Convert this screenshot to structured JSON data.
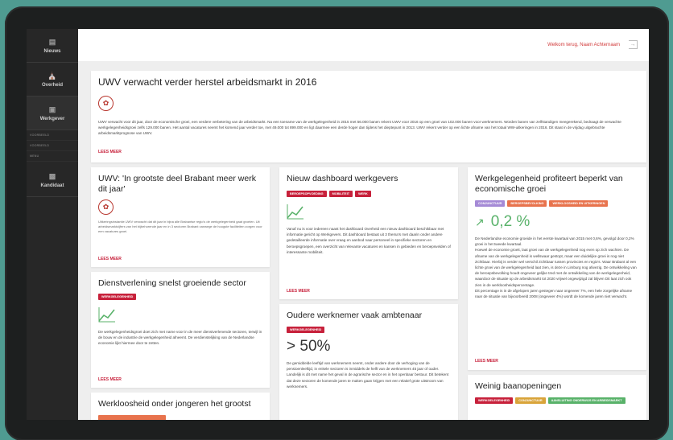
{
  "colors": {
    "accent": "#c7213b",
    "sidebar_bg": "#272727",
    "tag_purple": "#a58ad6",
    "tag_orange": "#e8734d",
    "tag_yellow": "#d9a43a",
    "tag_green": "#59b26a",
    "positive": "#59b26a"
  },
  "sidebar": {
    "items": [
      {
        "label": "Nieuws",
        "icon": "newspaper-icon"
      },
      {
        "label": "Overheid",
        "icon": "government-building-icon"
      },
      {
        "label": "Werkgever",
        "icon": "briefcase-icon"
      },
      {
        "label": "Kandidaat",
        "icon": "person-card-icon"
      }
    ],
    "subitems": [
      "Voorbeeld",
      "Voorbeeld",
      "Menu"
    ]
  },
  "topbar": {
    "welcome": "Welkom terug, Naam Achternaam"
  },
  "cards": {
    "main": {
      "title": "UWV verwacht verder herstel arbeidsmarkt in 2016",
      "icon": "flame-icon",
      "body": "UWV verwacht voor dit jaar, door de economische groei, een verdere verbetering van de arbeidsmarkt. Na een toename van de werkgelegenheid in 2015 met 56.000 banen rekent UWV voor 2016 op een groei van 102.000 banen voor werknemers. Worden banen van zelfstandigen meegerekend, bedraagt de verwachte werkgelegenheidsgroei zelfs 129.000 banen. Het aantal vacatures neemt het komend jaar verder toe, met 49.000 tot 899.000 en ligt daarmee een derde hoger dan tijdens het dieptepunt in 2013. UWV rekent verder op een lichte afname van het totaal WW-uitkeringen in 2016. Dit staat in de vrijdag uitgebrachte arbeidsmarktprognose van UWV.",
      "more": "LEES MEER"
    },
    "brabant": {
      "title": "UWV: 'In grootste deel Brabant meer werk dit jaar'",
      "icon": "flame-icon",
      "body": "Uitkeringsinstantie UWV verwacht dat dit jaar in bijna alle Brabantse regio's de werkgelegenheid gaat groeien. Uit arbeidsmarktcijfers van het bijbehorende jaar en in 3 sectoren Brabant vanwege de hoogste faciliteiten zorgen voor een vacatures groei.",
      "more": "LEES MEER"
    },
    "dienstverlening": {
      "title": "Dienstverlening snelst groeiende sector",
      "tags": [
        {
          "label": "Werkgelegenheid",
          "color": "#c7213b"
        }
      ],
      "icon": "line-chart-icon",
      "body": "De werkgelegenheidsgroei doet zich met name voor in de meer dienstverlenende sectoren, terwijl in de bouw en de industrie de werkgelegenheid afneemt. De verdienstelijking van de Nederlandse economie lijkt hiermee door te zetten.",
      "more": "LEES MEER"
    },
    "jongeren": {
      "title": "Werkloosheid onder jongeren het grootst"
    },
    "dashboard": {
      "title": "Nieuw dashboard werkgevers",
      "tags": [
        {
          "label": "Beroepsopvoeding",
          "color": "#c7213b"
        },
        {
          "label": "Mobiliteit",
          "color": "#c7213b"
        },
        {
          "label": "Werk",
          "color": "#c7213b"
        }
      ],
      "icon": "line-chart-icon",
      "body": "Vanaf nu is voor iedereen naast het dashboard Overheid een nieuw dashboard beschikbaar met informatie gericht op Werkgevers. Dit dashboard bestaat uit 3 thema's met daarin onder andere gedetailleerde informatie over vraag en aanbod naar personeel in specifieke sectoren en beroepsgroepen, een overzicht van relevante vacatures en kansen in gebieden en beroepsvelden of interessante mobiliteit.",
      "more": "LEES MEER"
    },
    "ambtenaar": {
      "title": "Oudere werknemer vaak ambtenaar",
      "tags": [
        {
          "label": "Werkgelegenheid",
          "color": "#c7213b"
        }
      ],
      "stat": "> 50%",
      "body": "De gemiddelde leeftijd van werknemers neemt, onder andere door de verhoging van de pensioenleeftijd, in enkele sectoren is inmiddels de helft van de werknemers 45 jaar of ouder. Landelijk is dit met name het geval in de agrarische sector en in het openbaar bestuur. Dit betekent dat deze sectoren de komende jaren te maken gaan krijgen met een relatief grote uitstroom van werknemers."
    },
    "groei": {
      "title": "Werkgelegenheid profiteert beperkt van economische groei",
      "tags": [
        {
          "label": "Conjunctuur",
          "color": "#a58ad6"
        },
        {
          "label": "Beroepsbevolking",
          "color": "#e8734d"
        },
        {
          "label": "Werkloosheid en uitkeringen",
          "color": "#e8734d"
        }
      ],
      "icon": "arrow-up-right-icon",
      "stat": "0,2 %",
      "body": "De Nederlandse economie groeide in het eerste kwartaal van 2015 met 0,6%, gevolgd door 0,2% groei in het tweede kwartaal.\nHoewel de economie groeit, laat groei van de werkgelegenheid nog even op zich wachten. De afname van de werkgelegenheid is wellswaar gestopt, maar een duidelijke groei is nog niet zichtbaar. Hierbij is verder wel verschil zichtbaar tussen provincies en regio's. Waar Brabant al een lichte groei van de werkgelegenheid laat zien, is deze in Limburg nog afwezig. De ontwikkeling van de beroepsbevolking houdt ongeveer gelijke tred met de ontwikkeling van de werkgelegenheid, waardoor de situatie op de arbeidsmarkt tot 2020 vrijwel ongewijzigd zal blijven Dit laat zich ook zien in de werkloosheidspercentage.\nDit percentage is in de afgelopen jaren gestegen naar ongeveer 7%, een hele zorgelijke afname naar de situatie van bijvoorbeeld 2008 (ongeveer 4%) wordt de komende jaren niet verwacht.",
      "more": "LEES MEER"
    },
    "baanopeningen": {
      "title": "Weinig baanopeningen",
      "tags": [
        {
          "label": "Werkgelegenheid",
          "color": "#c7213b"
        },
        {
          "label": "Conjunctuur",
          "color": "#d9a43a"
        },
        {
          "label": "Aansluiting onderwijs en arbeidsmarkt",
          "color": "#59b26a"
        }
      ]
    }
  }
}
